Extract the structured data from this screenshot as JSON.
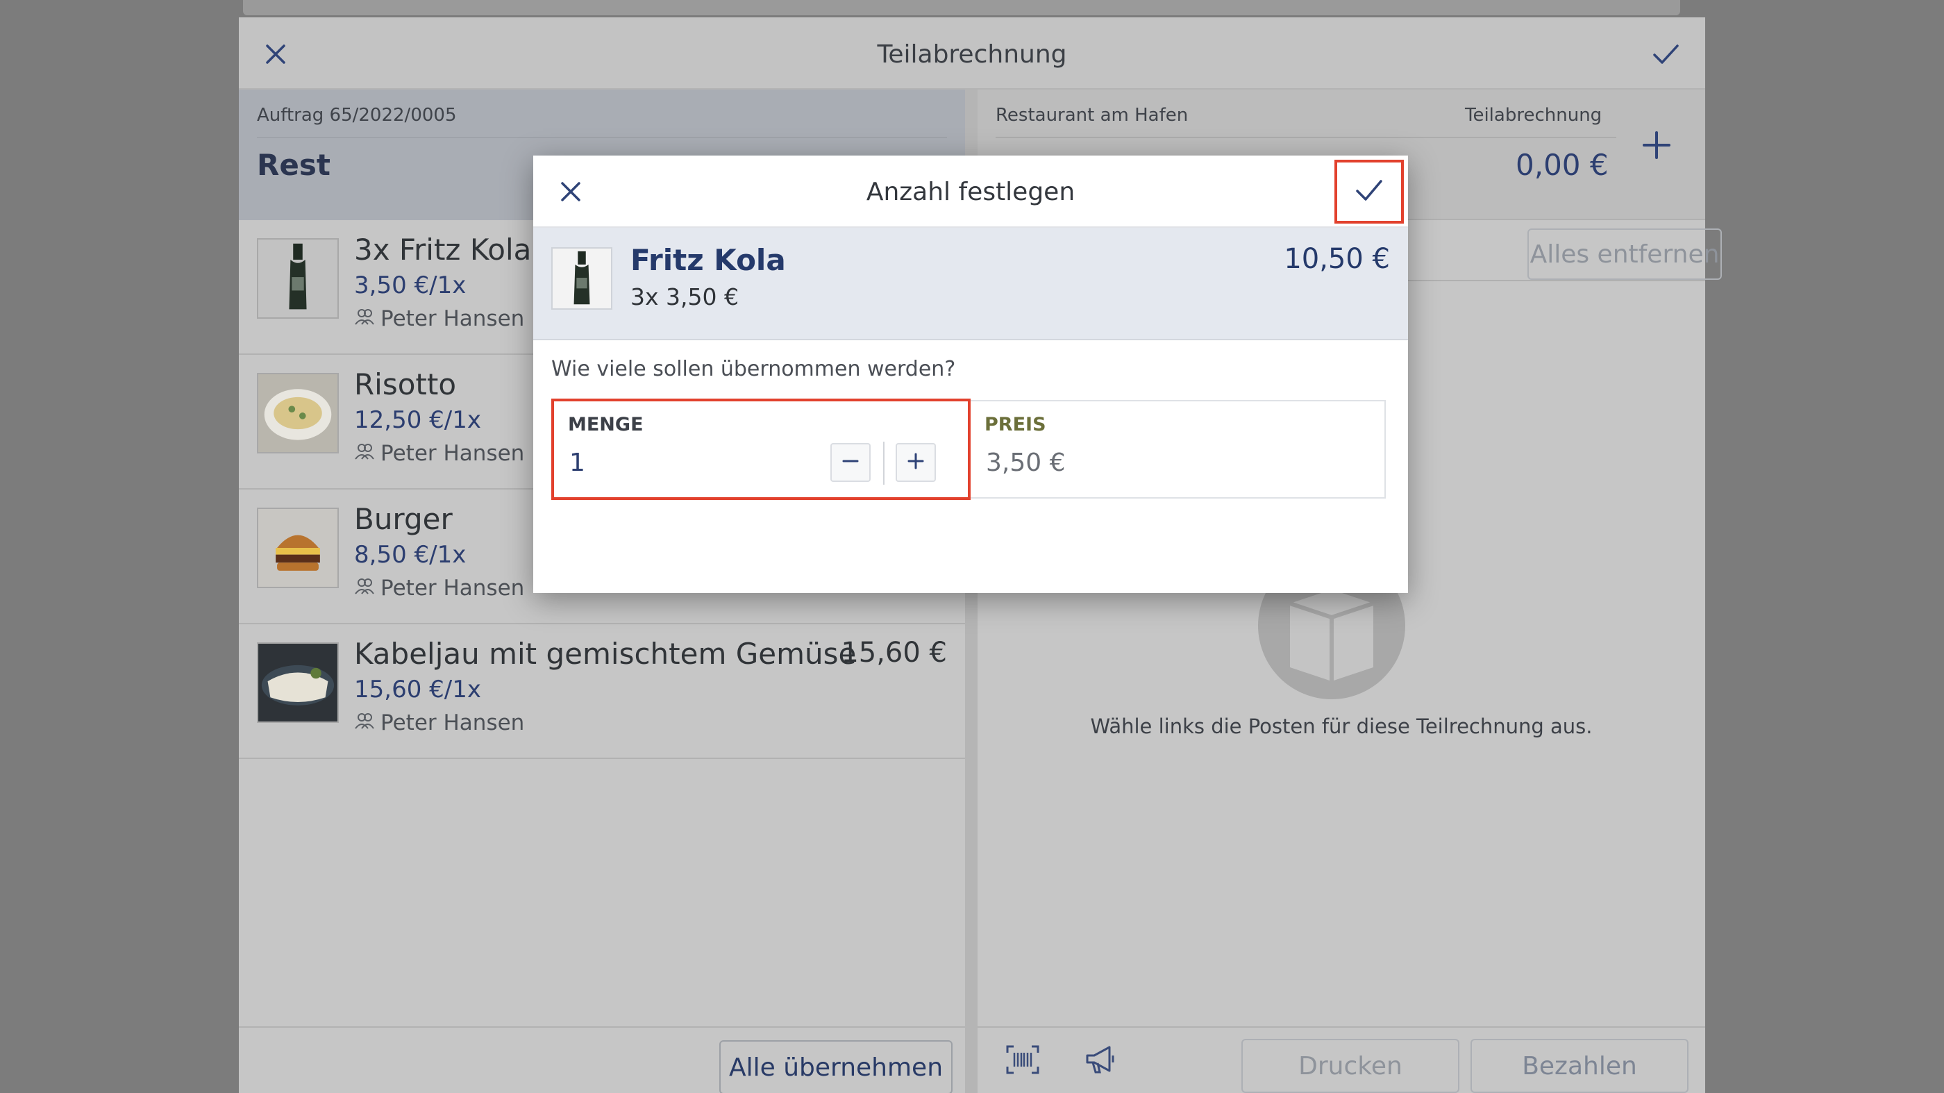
{
  "window": {
    "title": "Teilabrechnung"
  },
  "left": {
    "order_no": "Auftrag 65/2022/0005",
    "section_label": "Rest",
    "items": [
      {
        "name": "3x Fritz Kola",
        "unit_price": "3,50 €/1x",
        "person": "Peter Hansen",
        "total": ""
      },
      {
        "name": "Risotto",
        "unit_price": "12,50 €/1x",
        "person": "Peter Hansen",
        "total": ""
      },
      {
        "name": "Burger",
        "unit_price": "8,50 €/1x",
        "person": "Peter Hansen",
        "total": ""
      },
      {
        "name": "Kabeljau mit gemischtem Gemüse",
        "unit_price": "15,60 €/1x",
        "person": "Peter Hansen",
        "total": "15,60 €"
      }
    ],
    "take_all_label": "Alle übernehmen"
  },
  "right": {
    "restaurant": "Restaurant am Hafen",
    "bill_label": "Teilabrechnung",
    "total": "0,00 €",
    "remove_all_label": "Alles entfernen",
    "empty_message": "Wähle links die Posten für diese Teilrechnung aus.",
    "print_label": "Drucken",
    "pay_label": "Bezahlen"
  },
  "modal": {
    "title": "Anzahl festlegen",
    "product_name": "Fritz Kola",
    "product_qty_line": "3x 3,50 €",
    "product_total": "10,50 €",
    "question": "Wie viele sollen übernommen werden?",
    "quantity_label": "MENGE",
    "quantity_value": "1",
    "price_label": "PREIS",
    "price_value": "3,50 €"
  },
  "colors": {
    "accent": "#253a6b",
    "highlight": "#e2412d"
  },
  "icons": {
    "close": "close-icon",
    "confirm": "checkmark-icon",
    "add": "plus-icon",
    "minus": "minus-icon",
    "person": "people-icon",
    "barcode": "barcode-icon",
    "announce": "megaphone-icon",
    "empty": "box-icon"
  }
}
